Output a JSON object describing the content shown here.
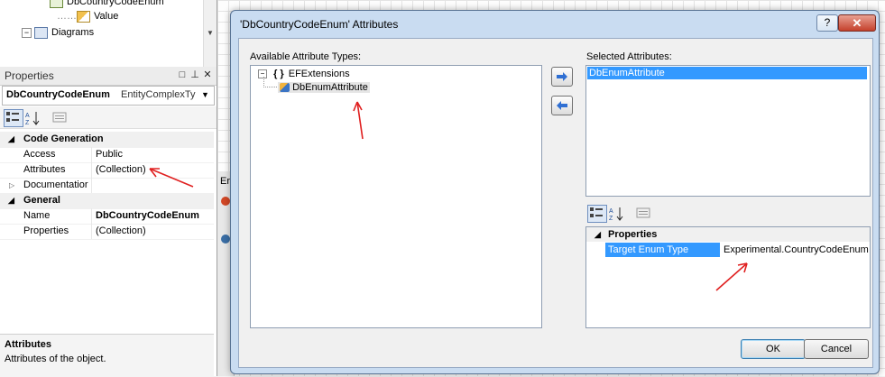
{
  "solution_tree": {
    "items": [
      {
        "label": "DbCountryCodeEnum",
        "icon": "class-icon"
      },
      {
        "label": "Value",
        "icon": "property-icon"
      },
      {
        "label": "Diagrams",
        "icon": "folder-diagram-icon"
      }
    ]
  },
  "properties_panel": {
    "title": "Properties",
    "object_name": "DbCountryCodeEnum",
    "object_type": "EntityComplexTy",
    "categories": [
      {
        "label": "Code Generation",
        "rows": [
          {
            "name": "Access",
            "value": "Public",
            "bold": false
          },
          {
            "name": "Attributes",
            "value": "(Collection)",
            "bold": false
          },
          {
            "name": "Documentatior",
            "value": "",
            "bold": false,
            "expandable": true
          }
        ]
      },
      {
        "label": "General",
        "rows": [
          {
            "name": "Name",
            "value": "DbCountryCodeEnum",
            "bold": true
          },
          {
            "name": "Properties",
            "value": "(Collection)",
            "bold": false
          }
        ]
      }
    ],
    "description_title": "Attributes",
    "description_text": "Attributes of the object."
  },
  "designer": {
    "error_strip_label": "Er"
  },
  "dialog": {
    "title": "'DbCountryCodeEnum' Attributes",
    "help_label": "?",
    "close_label": "✕",
    "available_label": "Available Attribute Types:",
    "available_tree": {
      "root_label": "EFExtensions",
      "root_prefix": "{ }",
      "child_label": "DbEnumAttribute"
    },
    "selected_label": "Selected Attributes:",
    "selected_items": [
      "DbEnumAttribute"
    ],
    "properties_section": {
      "category": "Properties",
      "name": "Target Enum Type",
      "value": "Experimental.CountryCodeEnum"
    },
    "ok_label": "OK",
    "cancel_label": "Cancel"
  },
  "annotation_color": "#e02020"
}
